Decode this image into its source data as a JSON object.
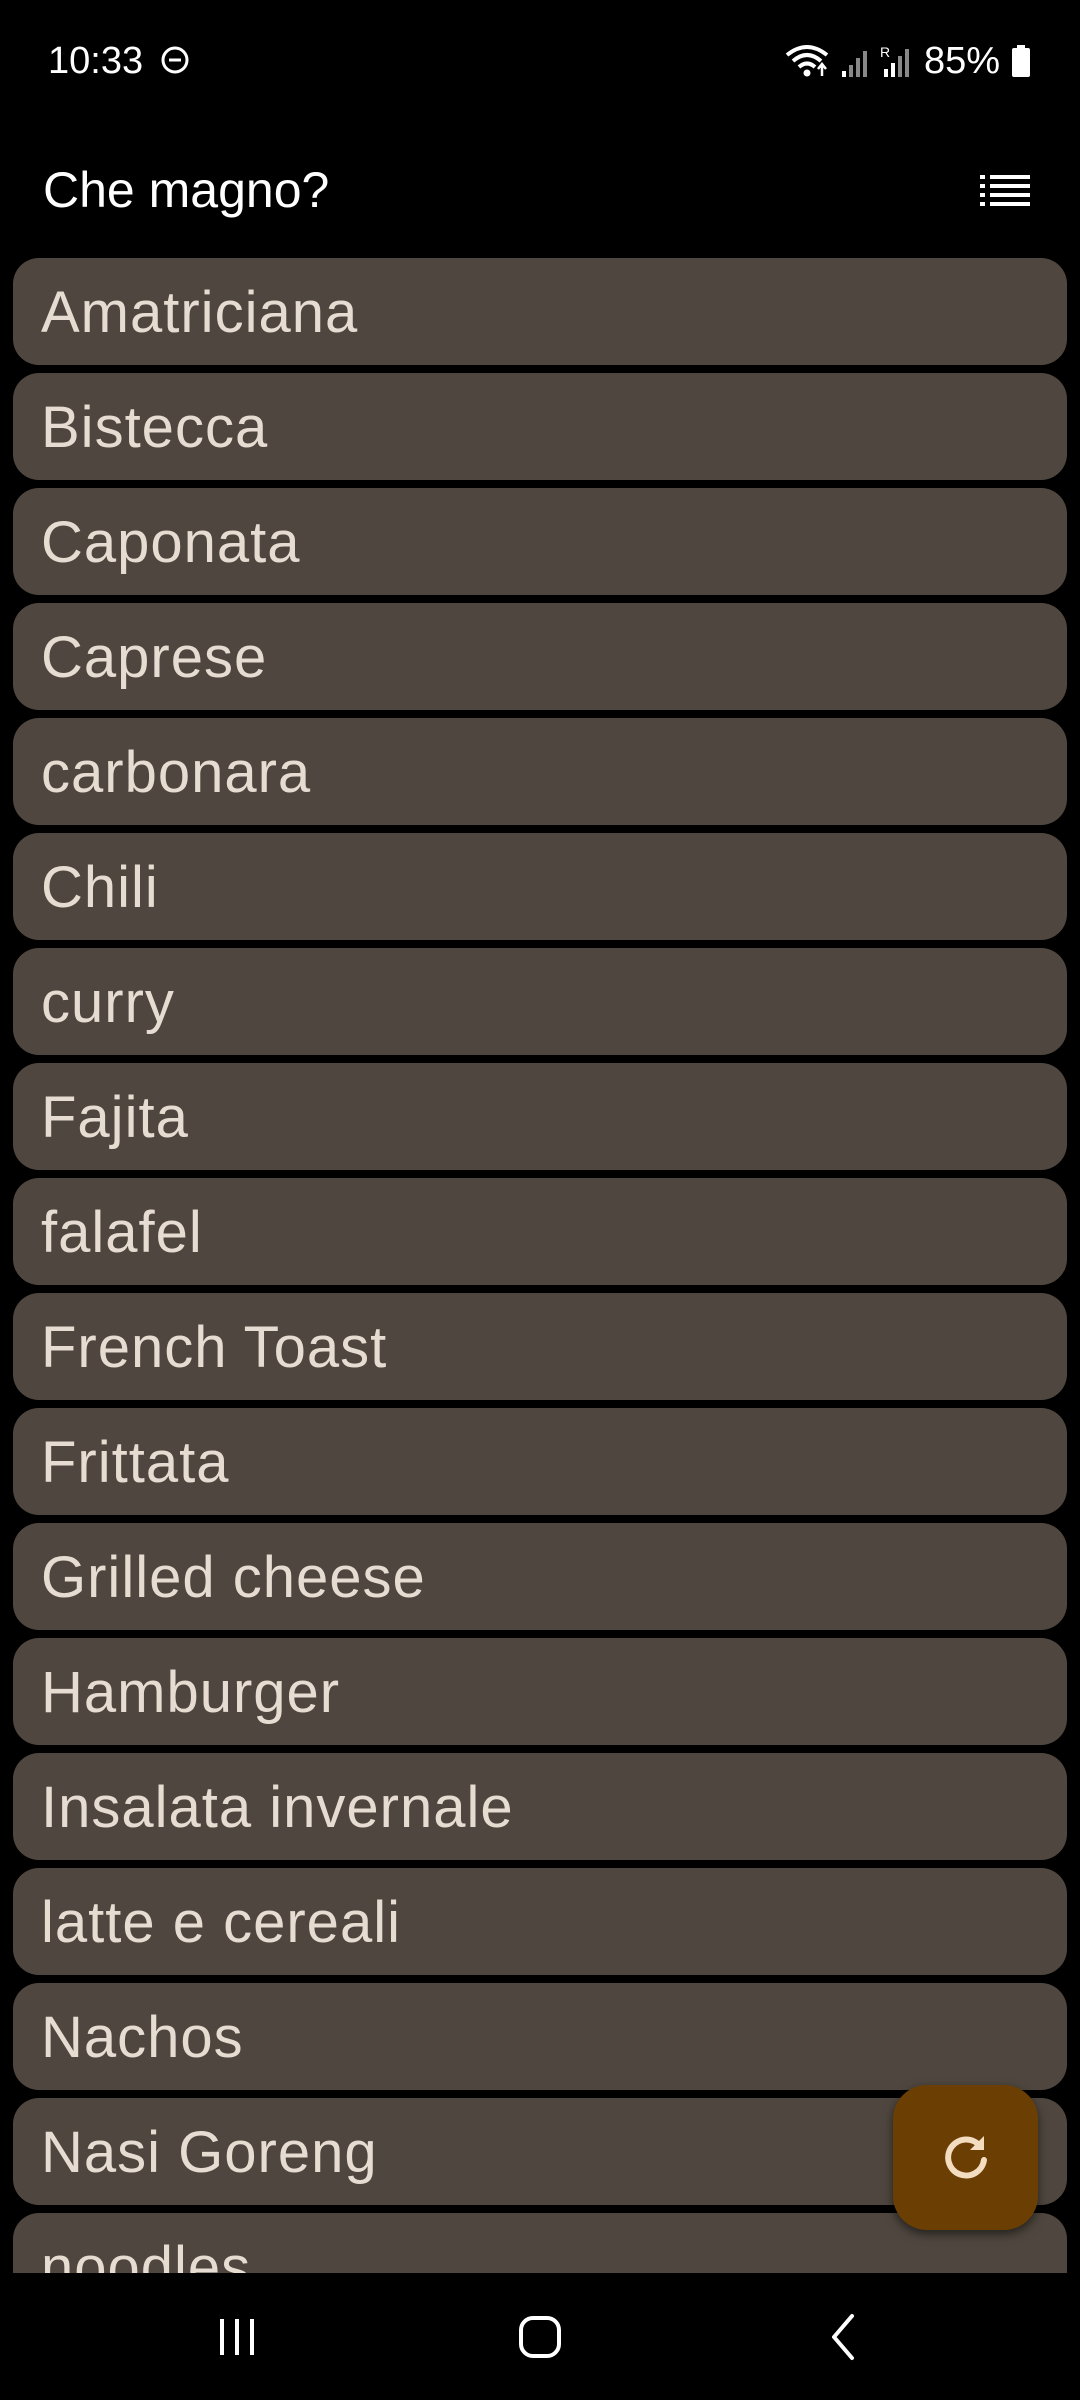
{
  "status_bar": {
    "time": "10:33",
    "battery": "85%",
    "icons": [
      "do-not-disturb-icon",
      "wifi-icon",
      "signal-icon",
      "signal-roaming-icon",
      "battery-icon"
    ]
  },
  "app_bar": {
    "title": "Che magno?",
    "menu_icon": "list-icon"
  },
  "food_list": {
    "items": [
      "Amatriciana",
      "Bistecca",
      "Caponata",
      "Caprese",
      "carbonara",
      "Chili",
      "curry",
      "Fajita",
      "falafel",
      "French Toast",
      "Frittata",
      "Grilled cheese",
      "Hamburger",
      "Insalata invernale",
      "latte e cereali",
      "Nachos",
      "Nasi Goreng",
      "noodles"
    ]
  },
  "fab": {
    "icon": "refresh-icon"
  },
  "nav_bar": {
    "icons": [
      "recents-icon",
      "home-icon",
      "back-icon"
    ]
  },
  "colors": {
    "background": "#000000",
    "item_background": "#4f473f",
    "item_text": "#e6dcd2",
    "fab_background": "#6b3f04",
    "fab_icon": "#f3dcc0"
  }
}
